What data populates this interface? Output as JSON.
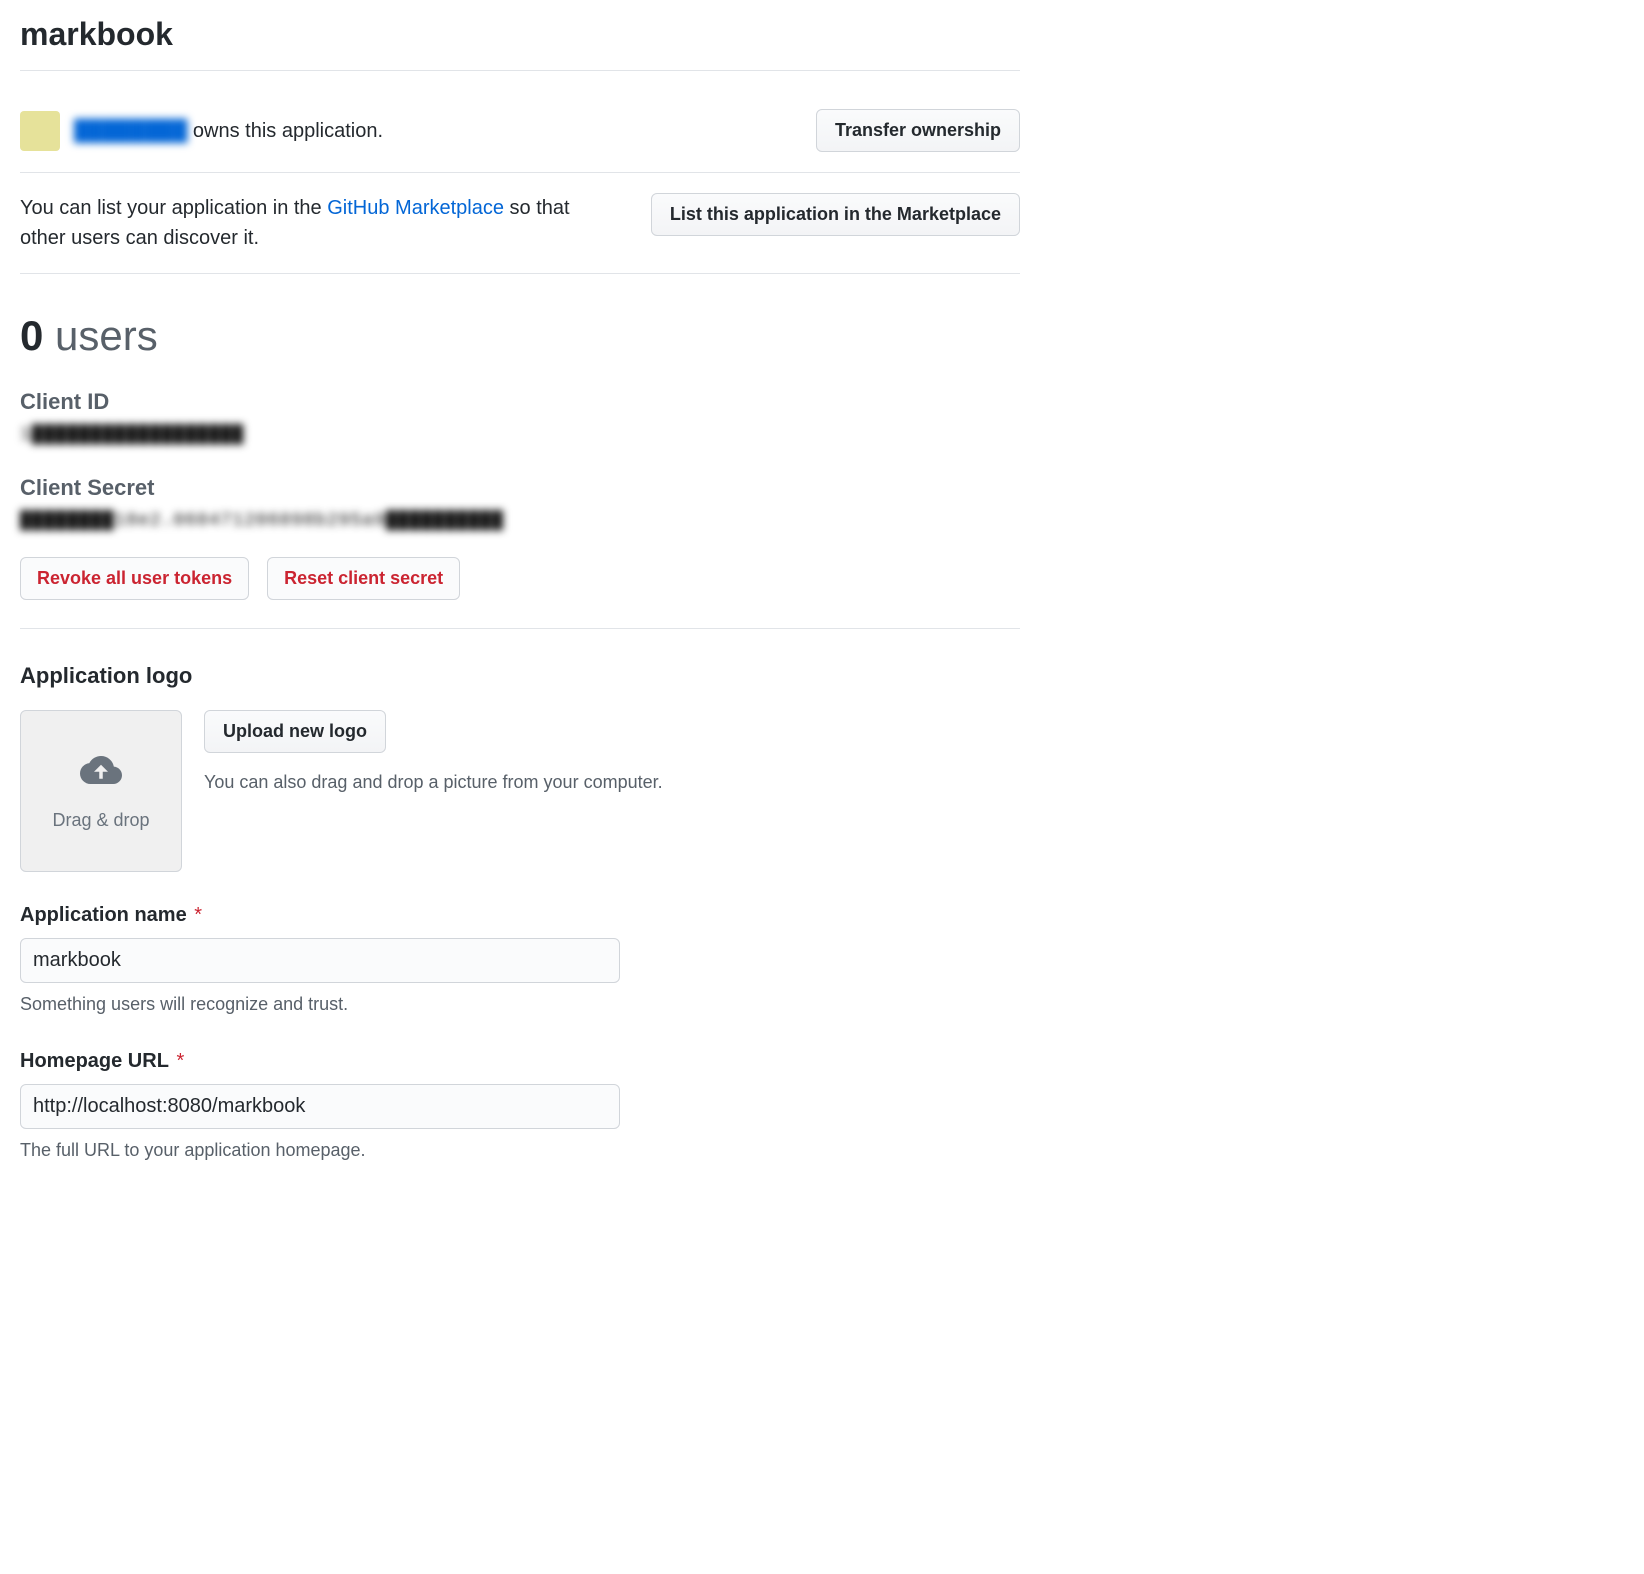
{
  "app": {
    "title": "markbook"
  },
  "owner": {
    "name_redacted": "████████",
    "owns_text": "owns this application.",
    "transfer_button": "Transfer ownership"
  },
  "marketplace": {
    "text_pre": "You can list your application in the ",
    "link_text": "GitHub Marketplace",
    "text_post": " so that other users can discover it.",
    "list_button": "List this application in the Marketplace"
  },
  "stats": {
    "user_count": "0",
    "user_label": "users"
  },
  "client": {
    "id_label": "Client ID",
    "id_value_redacted": "1██████████████████",
    "secret_label": "Client Secret",
    "secret_value_redacted": "████████18e2.060471206098b295a9██████████"
  },
  "actions": {
    "revoke_tokens": "Revoke all user tokens",
    "reset_secret": "Reset client secret"
  },
  "logo": {
    "heading": "Application logo",
    "drag_drop": "Drag & drop",
    "upload_button": "Upload new logo",
    "hint": "You can also drag and drop a picture from your computer."
  },
  "form": {
    "name": {
      "label": "Application name",
      "value": "markbook",
      "hint": "Something users will recognize and trust."
    },
    "homepage": {
      "label": "Homepage URL",
      "value": "http://localhost:8080/markbook",
      "hint": "The full URL to your application homepage."
    }
  }
}
